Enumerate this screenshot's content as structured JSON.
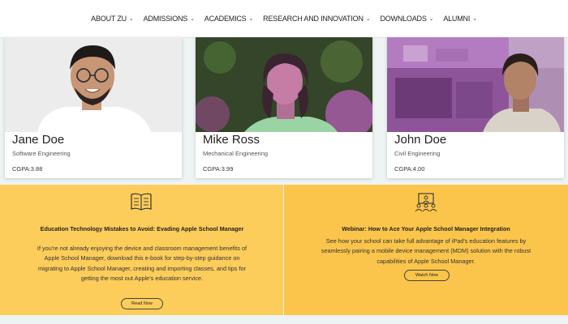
{
  "nav": {
    "items": [
      {
        "label": "ABOUT ZU"
      },
      {
        "label": "ADMISSIONS"
      },
      {
        "label": "ACADEMICS"
      },
      {
        "label": "RESEARCH AND INNOVATION"
      },
      {
        "label": "DOWNLOADS"
      },
      {
        "label": "ALUMNI"
      }
    ]
  },
  "students": [
    {
      "name": "Jane Doe",
      "department": "Software Engineering",
      "cgpa": "CGPA:3.88"
    },
    {
      "name": "Mike Ross",
      "department": "Mechanical Engineering",
      "cgpa": "CGPA:3.99"
    },
    {
      "name": "John Doe",
      "department": "Civil Engineering",
      "cgpa": "CGPA:4.00"
    }
  ],
  "promos": [
    {
      "icon": "book-icon",
      "title": "Education Technology Mistakes to Avoid: Evading Apple School Manager",
      "body": "If you're not already enjoying the device and classroom management benefits of Apple School Manager, download this e-book for step-by-step guidance on migrating to Apple School Manager, creating and importing classes, and tips for getting the most out Apple's education service.",
      "button": "Read Now"
    },
    {
      "icon": "webinar-icon",
      "title": "Webinar: How to Ace Your Apple School Manager Integration",
      "body": "See how your school can take full advantage of iPad's education features by seamlessly pairing a mobile device management (MDM) solution with the robust capabilities of Apple School Manager.",
      "button": "Watch Now"
    }
  ],
  "colors": {
    "promo_left": "#fdcd5b",
    "promo_right": "#fbc54b",
    "tint": "#a14fa6"
  }
}
